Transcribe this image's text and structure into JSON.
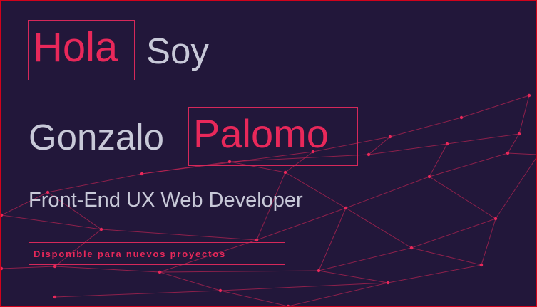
{
  "hero": {
    "greeting_word": "Hola",
    "greeting_soy": "Soy",
    "first_name": "Gonzalo",
    "last_name": "Palomo",
    "job_title": "Front-End UX Web Developer",
    "availability": "Disponible para nuevos proyectos"
  },
  "theme": {
    "background": "#22173a",
    "accent": "#e8285a",
    "text": "#c8c9d8",
    "frame": "#d0021b"
  }
}
